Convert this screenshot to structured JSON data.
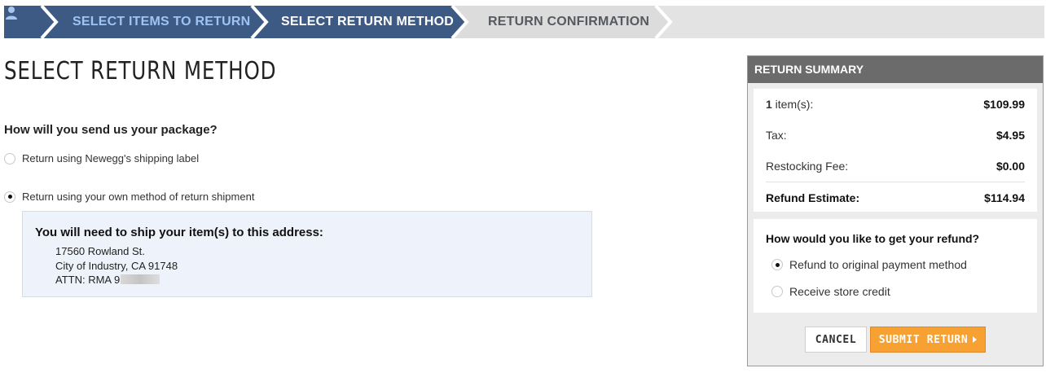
{
  "stepper": {
    "steps": [
      {
        "label": "SELECT ITEMS TO RETURN",
        "state": "completed"
      },
      {
        "label": "SELECT RETURN METHOD",
        "state": "current"
      },
      {
        "label": "RETURN CONFIRMATION",
        "state": "upcoming"
      }
    ],
    "icon": "user-icon"
  },
  "main": {
    "title": "SELECT RETURN METHOD",
    "question": "How will you send us your package?",
    "options": [
      {
        "label": "Return using Newegg's shipping label",
        "checked": false
      },
      {
        "label": "Return using your own method of return shipment",
        "checked": true
      }
    ],
    "address": {
      "heading": "You will need to ship your item(s) to this address:",
      "line1": "17560 Rowland St.",
      "line2": "City of Industry, CA 91748",
      "line3": "ATTN: RMA 9"
    }
  },
  "summary": {
    "title": "RETURN SUMMARY",
    "items_count": "1",
    "items_label": " item(s):",
    "items_value": "$109.99",
    "tax_label": "Tax:",
    "tax_value": "$4.95",
    "restock_label": "Restocking Fee:",
    "restock_value": "$0.00",
    "refund_label": "Refund Estimate:",
    "refund_value": "$114.94",
    "refund_question": "How would you like to get your refund?",
    "refund_options": [
      {
        "label": "Refund to original payment method",
        "checked": true
      },
      {
        "label": "Receive store credit",
        "checked": false
      }
    ],
    "cancel_label": "CANCEL",
    "submit_label": "SUBMIT RETURN"
  },
  "colors": {
    "step_completed": "#3d5a85",
    "step_current": "#3d5a85",
    "step_upcoming": "#e0e0e0",
    "submit": "#f7a133"
  }
}
